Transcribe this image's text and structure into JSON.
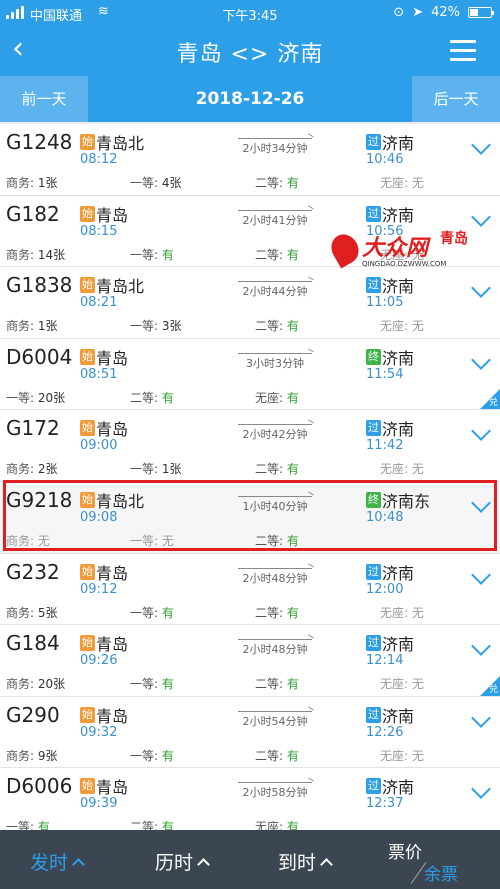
{
  "status": {
    "carrier": "中国联通",
    "time": "下午3:45",
    "battery_text": "42%",
    "battery_level": 0.42
  },
  "nav": {
    "title": "青岛 <> 济南",
    "back_icon": "chevron-left-icon",
    "menu_icon": "list-icon"
  },
  "datebar": {
    "prev": "前一天",
    "date": "2018-12-26",
    "next": "后一天"
  },
  "labels": {
    "business": "商务:",
    "first": "一等:",
    "second": "二等:",
    "standing": "无座:",
    "no_seat": "无座:"
  },
  "trains": [
    {
      "code": "G1248",
      "from_tag": "始",
      "from": "青岛北",
      "dep": "08:12",
      "duration": "2小时34分钟",
      "to_tag": "过",
      "to": "济南",
      "arr": "10:46",
      "seats": [
        {
          "label": "商务:",
          "value": "1张",
          "ok": false
        },
        {
          "label": "一等:",
          "value": "4张",
          "ok": false
        },
        {
          "label": "二等:",
          "value": "有",
          "ok": true
        },
        {
          "label": "无座:",
          "value": "无",
          "ok": false,
          "dim": true
        }
      ]
    },
    {
      "code": "G182",
      "from_tag": "始",
      "from": "青岛",
      "dep": "08:15",
      "duration": "2小时41分钟",
      "to_tag": "过",
      "to": "济南",
      "arr": "10:56",
      "seats": [
        {
          "label": "商务:",
          "value": "14张",
          "ok": false
        },
        {
          "label": "一等:",
          "value": "有",
          "ok": true
        },
        {
          "label": "二等:",
          "value": "有",
          "ok": true
        },
        {
          "label": "无座:",
          "value": "无",
          "ok": false,
          "dim": true
        }
      ]
    },
    {
      "code": "G1838",
      "from_tag": "始",
      "from": "青岛北",
      "dep": "08:21",
      "duration": "2小时44分钟",
      "to_tag": "过",
      "to": "济南",
      "arr": "11:05",
      "seats": [
        {
          "label": "商务:",
          "value": "1张",
          "ok": false
        },
        {
          "label": "一等:",
          "value": "3张",
          "ok": false
        },
        {
          "label": "二等:",
          "value": "有",
          "ok": true
        },
        {
          "label": "无座:",
          "value": "无",
          "ok": false,
          "dim": true
        }
      ]
    },
    {
      "code": "D6004",
      "from_tag": "始",
      "from": "青岛",
      "dep": "08:51",
      "duration": "3小时3分钟",
      "to_tag": "终",
      "to": "济南",
      "arr": "11:54",
      "corner": "兑",
      "seats": [
        {
          "label": "一等:",
          "value": "20张",
          "ok": false
        },
        {
          "label": "二等:",
          "value": "有",
          "ok": true
        },
        {
          "label": "无座:",
          "value": "有",
          "ok": true
        }
      ]
    },
    {
      "code": "G172",
      "from_tag": "始",
      "from": "青岛",
      "dep": "09:00",
      "duration": "2小时42分钟",
      "to_tag": "过",
      "to": "济南",
      "arr": "11:42",
      "seats": [
        {
          "label": "商务:",
          "value": "2张",
          "ok": false
        },
        {
          "label": "一等:",
          "value": "1张",
          "ok": false
        },
        {
          "label": "二等:",
          "value": "有",
          "ok": true
        },
        {
          "label": "无座:",
          "value": "无",
          "ok": false,
          "dim": true
        }
      ]
    },
    {
      "code": "G9218",
      "from_tag": "始",
      "from": "青岛北",
      "dep": "09:08",
      "duration": "1小时40分钟",
      "to_tag": "终",
      "to": "济南东",
      "arr": "10:48",
      "highlight": true,
      "seats": [
        {
          "label": "商务:",
          "value": "无",
          "ok": false,
          "dim": true
        },
        {
          "label": "一等:",
          "value": "无",
          "ok": false,
          "dim": true
        },
        {
          "label": "二等:",
          "value": "有",
          "ok": true
        }
      ]
    },
    {
      "code": "G232",
      "from_tag": "始",
      "from": "青岛",
      "dep": "09:12",
      "duration": "2小时48分钟",
      "to_tag": "过",
      "to": "济南",
      "arr": "12:00",
      "seats": [
        {
          "label": "商务:",
          "value": "5张",
          "ok": false
        },
        {
          "label": "一等:",
          "value": "有",
          "ok": true
        },
        {
          "label": "二等:",
          "value": "有",
          "ok": true
        },
        {
          "label": "无座:",
          "value": "无",
          "ok": false,
          "dim": true
        }
      ]
    },
    {
      "code": "G184",
      "from_tag": "始",
      "from": "青岛",
      "dep": "09:26",
      "duration": "2小时48分钟",
      "to_tag": "过",
      "to": "济南",
      "arr": "12:14",
      "corner": "兑",
      "seats": [
        {
          "label": "商务:",
          "value": "20张",
          "ok": false
        },
        {
          "label": "一等:",
          "value": "有",
          "ok": true
        },
        {
          "label": "二等:",
          "value": "有",
          "ok": true
        },
        {
          "label": "无座:",
          "value": "无",
          "ok": false,
          "dim": true
        }
      ]
    },
    {
      "code": "G290",
      "from_tag": "始",
      "from": "青岛",
      "dep": "09:32",
      "duration": "2小时54分钟",
      "to_tag": "过",
      "to": "济南",
      "arr": "12:26",
      "seats": [
        {
          "label": "商务:",
          "value": "9张",
          "ok": false
        },
        {
          "label": "一等:",
          "value": "有",
          "ok": true
        },
        {
          "label": "二等:",
          "value": "有",
          "ok": true
        },
        {
          "label": "无座:",
          "value": "无",
          "ok": false,
          "dim": true
        }
      ]
    },
    {
      "code": "D6006",
      "from_tag": "始",
      "from": "青岛",
      "dep": "09:39",
      "duration": "2小时58分钟",
      "to_tag": "过",
      "to": "济南",
      "arr": "12:37",
      "seats": [
        {
          "label": "一等:",
          "value": "有",
          "ok": true
        },
        {
          "label": "二等:",
          "value": "有",
          "ok": true
        },
        {
          "label": "无座:",
          "value": "有",
          "ok": true
        }
      ]
    }
  ],
  "watermark": {
    "brand": "大众网",
    "sub": "QINGDAO.DZWWW.COM",
    "city": "青岛"
  },
  "bottom": {
    "depart": "发时",
    "duration": "历时",
    "arrive": "到时",
    "price": "票价",
    "remain": "余票"
  },
  "colors": {
    "primary": "#2d9ee8",
    "start_tag": "#f29a38",
    "end_tag": "#3cb44a",
    "available": "#2ea02e",
    "highlight_border": "#e02020",
    "bottom_bar": "#3b4652"
  }
}
